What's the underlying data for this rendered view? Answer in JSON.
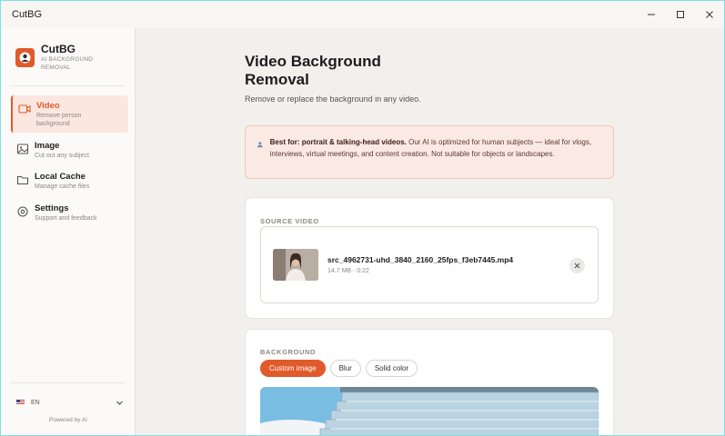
{
  "window": {
    "title": "CutBG"
  },
  "brand": {
    "name": "CutBG",
    "subtitle": "AI BACKGROUND REMOVAL"
  },
  "nav": [
    {
      "label": "Video",
      "sub": "Remove person background",
      "icon": "video-icon",
      "active": true
    },
    {
      "label": "Image",
      "sub": "Cut out any subject",
      "icon": "image-icon",
      "active": false
    },
    {
      "label": "Local Cache",
      "sub": "Manage cache files",
      "icon": "folder-icon",
      "active": false
    },
    {
      "label": "Settings",
      "sub": "Support and feedback",
      "icon": "settings-icon",
      "active": false
    }
  ],
  "language": {
    "code": "EN"
  },
  "footer": {
    "powered": "Powered by AI"
  },
  "page": {
    "title": "Video Background Removal",
    "subtitle": "Remove or replace the background in any video."
  },
  "notice": {
    "bold": "Best for: portrait & talking-head videos.",
    "text": " Our AI is optimized for human subjects — ideal for vlogs, interviews, virtual meetings, and content creation. Not suitable for objects or landscapes."
  },
  "source": {
    "heading": "SOURCE VIDEO",
    "file_name": "src_4962731-uhd_3840_2160_25fps_f3eb7445.mp4",
    "file_meta": "14.7 MB · 0:22"
  },
  "background": {
    "heading": "BACKGROUND",
    "options": [
      "Custom image",
      "Blur",
      "Solid color"
    ],
    "selected": "Custom image"
  },
  "colors": {
    "accent": "#e05a2b",
    "notice_bg": "#fbe9e3"
  }
}
